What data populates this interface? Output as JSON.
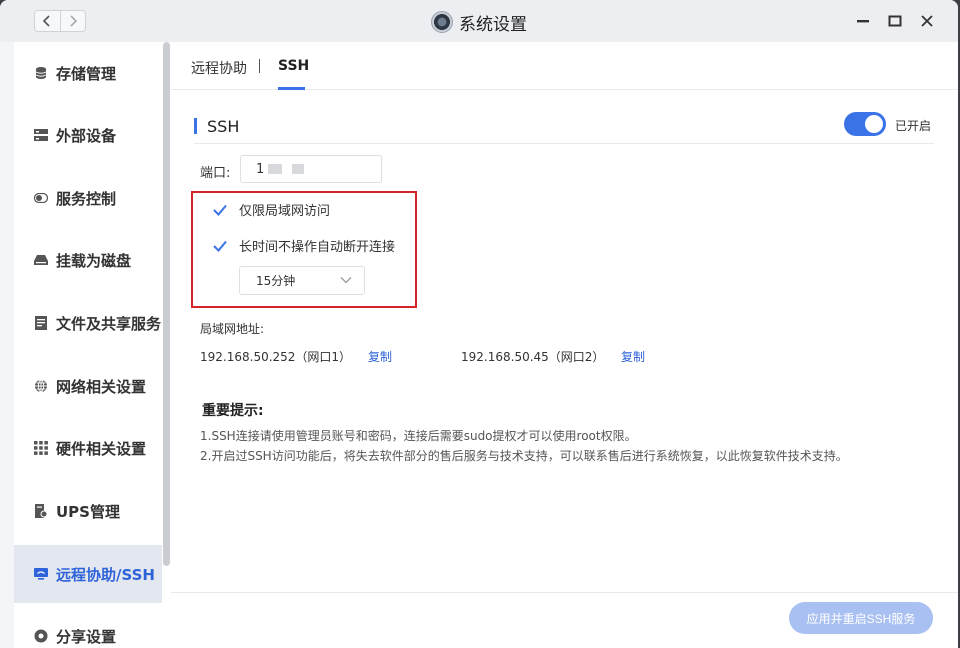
{
  "window": {
    "title": "系统设置",
    "icons": {
      "back": "chevron-left-icon",
      "forward": "chevron-right-icon",
      "minimize": "minimize-icon",
      "maximize": "maximize-icon",
      "close": "close-icon"
    }
  },
  "sidebar": {
    "items": [
      {
        "label": "存储管理",
        "icon": "database-icon"
      },
      {
        "label": "外部设备",
        "icon": "device-icon"
      },
      {
        "label": "服务控制",
        "icon": "toggle-icon"
      },
      {
        "label": "挂载为磁盘",
        "icon": "drive-icon"
      },
      {
        "label": "文件及共享服务",
        "icon": "file-icon"
      },
      {
        "label": "网络相关设置",
        "icon": "globe-icon"
      },
      {
        "label": "硬件相关设置",
        "icon": "grid-icon"
      },
      {
        "label": "UPS管理",
        "icon": "ups-icon"
      },
      {
        "label": "远程协助/SSH",
        "icon": "remote-icon",
        "active": true
      },
      {
        "label": "分享设置",
        "icon": "share-icon"
      }
    ]
  },
  "tabs": [
    {
      "label": "远程协助"
    },
    {
      "label": "SSH",
      "active": true
    }
  ],
  "ssh": {
    "section_title": "SSH",
    "toggle_status": "已开启",
    "enabled": true,
    "port_label": "端口:",
    "port_value": "1",
    "lan_only_label": "仅限局域网访问",
    "lan_only_checked": true,
    "auto_disconnect_label": "长时间不操作自动断开连接",
    "auto_disconnect_checked": true,
    "timeout_value": "15分钟"
  },
  "lan": {
    "label": "局域网地址:",
    "addresses": [
      {
        "text": "192.168.50.252（网口1）",
        "copy": "复制"
      },
      {
        "text": "192.168.50.45（网口2）",
        "copy": "复制"
      }
    ]
  },
  "tips": {
    "title": "重要提示:",
    "lines": [
      "1.SSH连接请使用管理员账号和密码，连接后需要sudo提权才可以使用root权限。",
      "2.开启过SSH访问功能后，将失去软件部分的售后服务与技术支持，可以联系售后进行系统恢复，以此恢复软件技术支持。"
    ]
  },
  "footer": {
    "apply_label": "应用并重启SSH服务"
  },
  "colors": {
    "accent": "#3a72e8",
    "highlight_border": "#d9232a",
    "apply_button_disabled": "#a9c0f2"
  }
}
